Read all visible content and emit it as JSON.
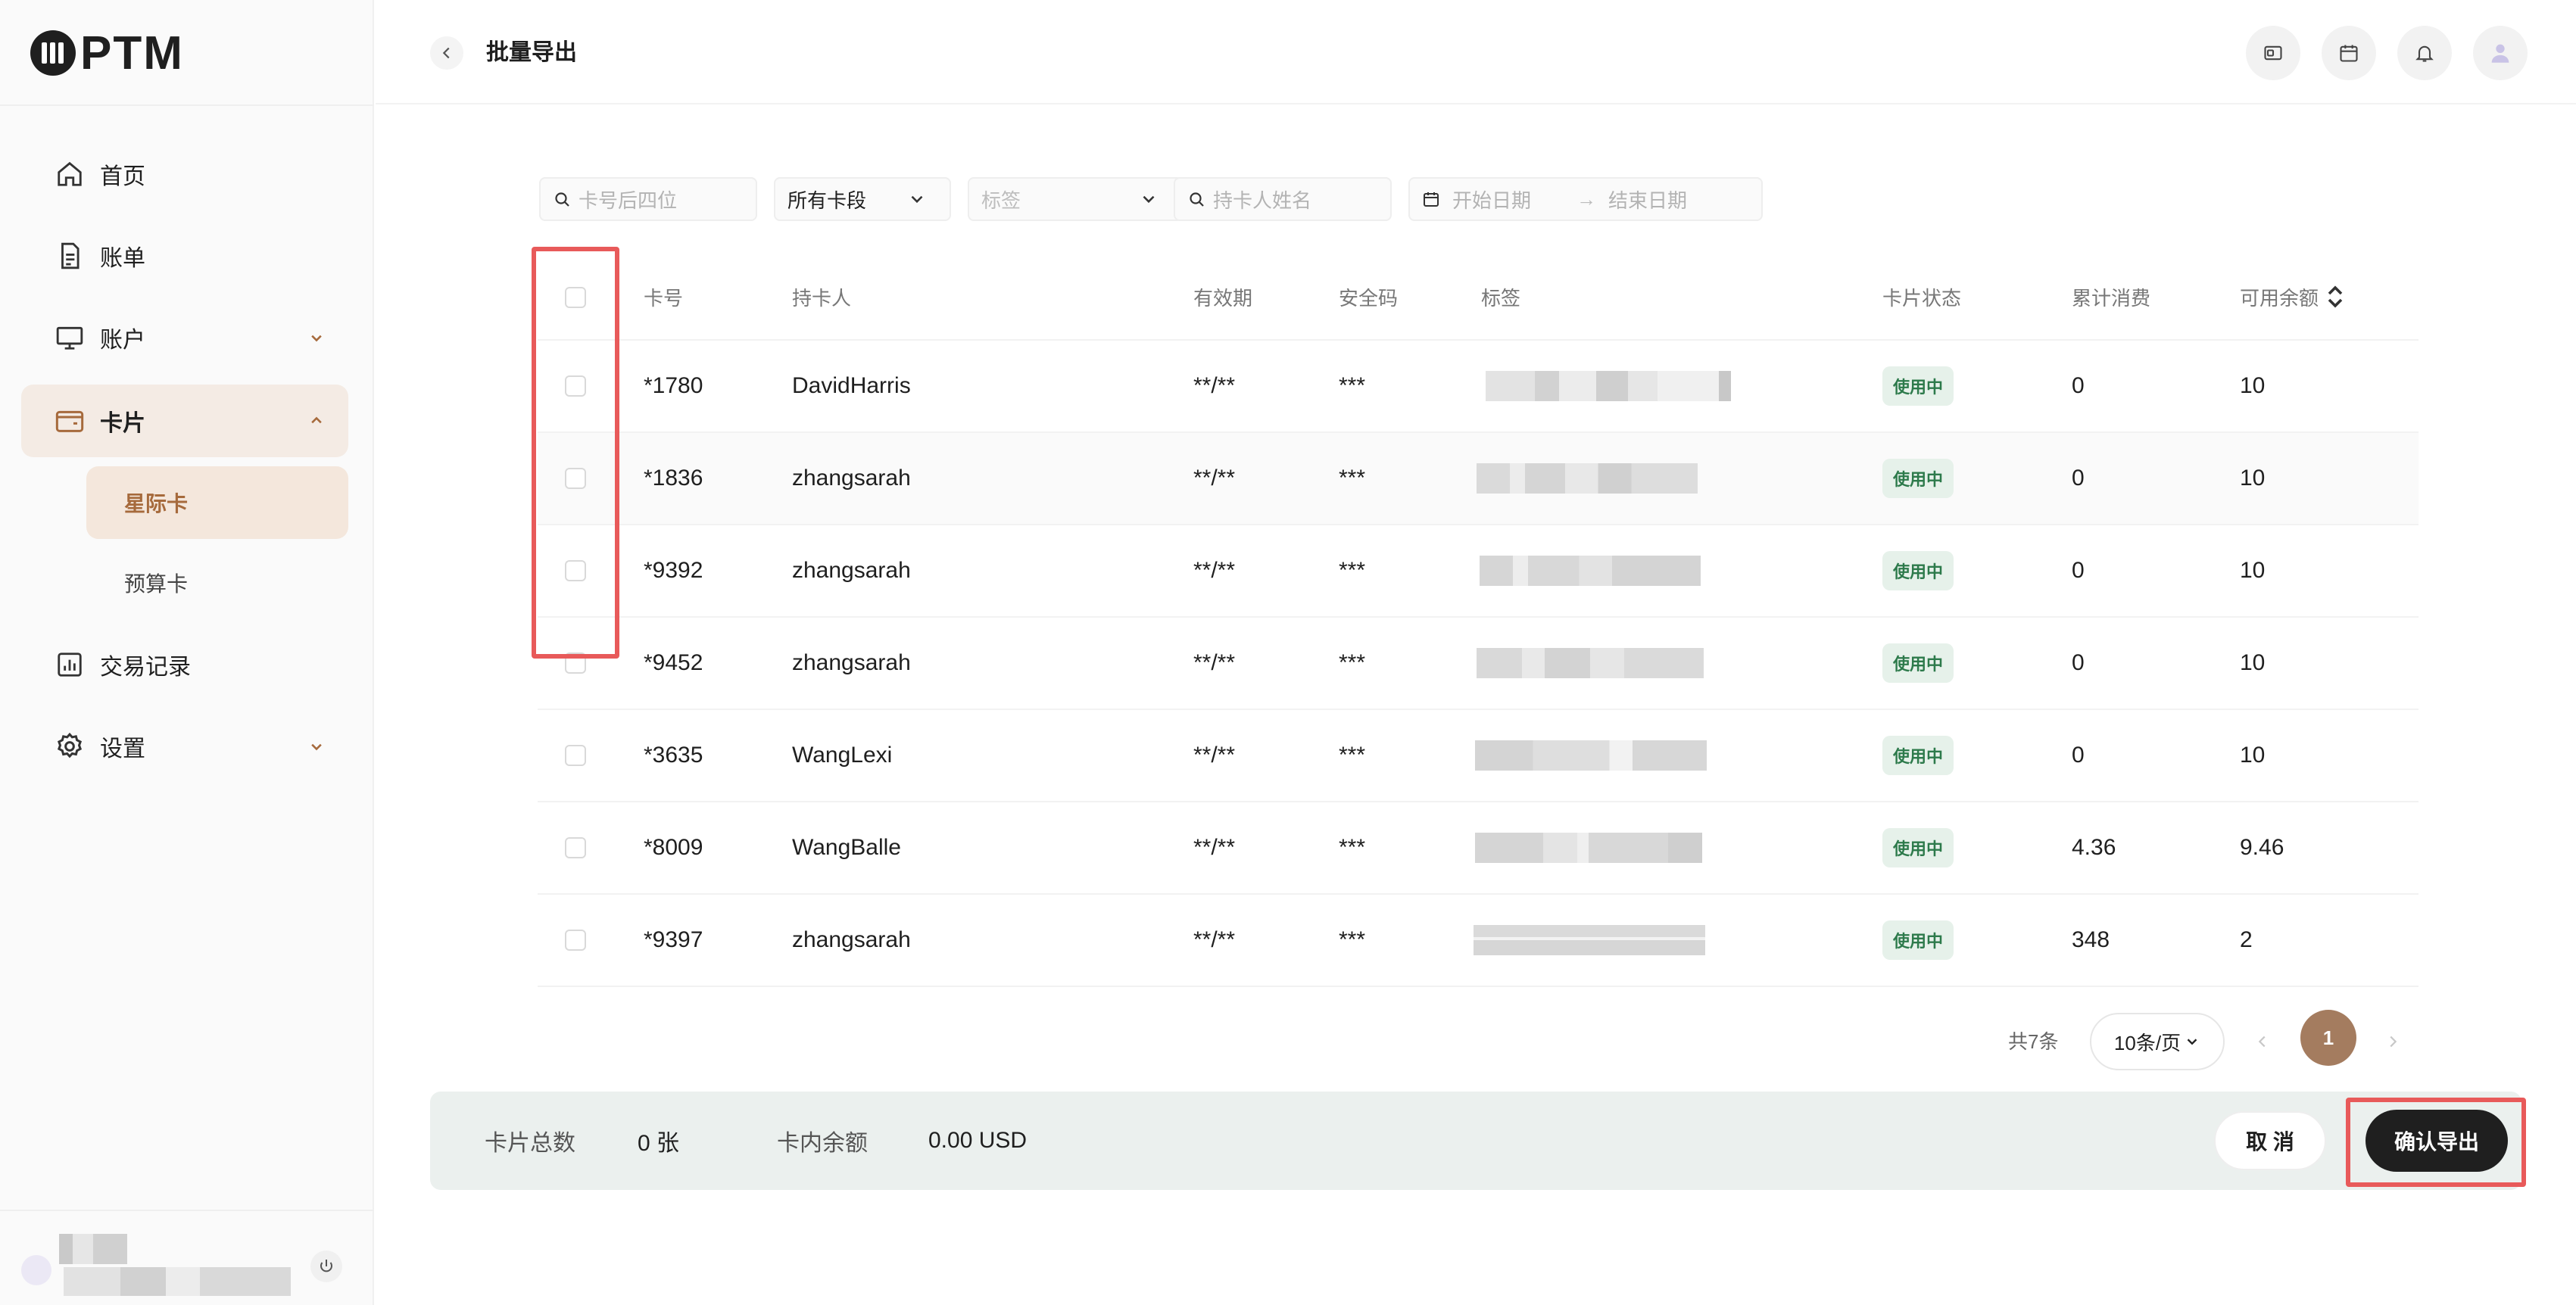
{
  "brand": {
    "name": "PTM"
  },
  "header": {
    "title": "批量导出",
    "icons": [
      "card-icon",
      "calendar-icon",
      "bell-icon",
      "user-avatar"
    ]
  },
  "sidebar": {
    "items": [
      {
        "label": "首页",
        "icon": "home-icon"
      },
      {
        "label": "账单",
        "icon": "document-icon"
      },
      {
        "label": "账户",
        "icon": "monitor-icon"
      },
      {
        "label": "卡片",
        "icon": "wallet-icon"
      },
      {
        "label": "交易记录",
        "icon": "chart-icon"
      },
      {
        "label": "设置",
        "icon": "gear-icon"
      }
    ],
    "sub_items": [
      {
        "label": "星际卡"
      },
      {
        "label": "预算卡"
      }
    ]
  },
  "filters": {
    "card_last4_placeholder": "卡号后四位",
    "card_segment": "所有卡段",
    "tag_placeholder": "标签",
    "holder_placeholder": "持卡人姓名",
    "start_date_placeholder": "开始日期",
    "end_date_placeholder": "结束日期"
  },
  "table": {
    "columns": [
      "卡号",
      "持卡人",
      "有效期",
      "安全码",
      "标签",
      "卡片状态",
      "累计消费",
      "可用余额"
    ],
    "rows": [
      {
        "card": "*1780",
        "holder": "DavidHarris",
        "expiry": "**/**",
        "cvv": "***",
        "status": "使用中",
        "spent": "0",
        "balance": "10"
      },
      {
        "card": "*1836",
        "holder": "zhangsarah",
        "expiry": "**/**",
        "cvv": "***",
        "status": "使用中",
        "spent": "0",
        "balance": "10"
      },
      {
        "card": "*9392",
        "holder": "zhangsarah",
        "expiry": "**/**",
        "cvv": "***",
        "status": "使用中",
        "spent": "0",
        "balance": "10"
      },
      {
        "card": "*9452",
        "holder": "zhangsarah",
        "expiry": "**/**",
        "cvv": "***",
        "status": "使用中",
        "spent": "0",
        "balance": "10"
      },
      {
        "card": "*3635",
        "holder": "WangLexi",
        "expiry": "**/**",
        "cvv": "***",
        "status": "使用中",
        "spent": "0",
        "balance": "10"
      },
      {
        "card": "*8009",
        "holder": "WangBalle",
        "expiry": "**/**",
        "cvv": "***",
        "status": "使用中",
        "spent": "4.36",
        "balance": "9.46"
      },
      {
        "card": "*9397",
        "holder": "zhangsarah",
        "expiry": "**/**",
        "cvv": "***",
        "status": "使用中",
        "spent": "348",
        "balance": "2"
      }
    ]
  },
  "pagination": {
    "total": "共7条",
    "page_size": "10条/页",
    "current": "1"
  },
  "footer": {
    "card_total_label": "卡片总数",
    "card_total_value": "0 张",
    "balance_label": "卡内余额",
    "balance_value": "0.00 USD",
    "cancel_label": "取 消",
    "confirm_label": "确认导出"
  },
  "colors": {
    "accent": "#a47c5f",
    "highlight": "#e85a5a",
    "badge_bg": "#e6f1ea",
    "badge_text": "#2d7a4b"
  }
}
